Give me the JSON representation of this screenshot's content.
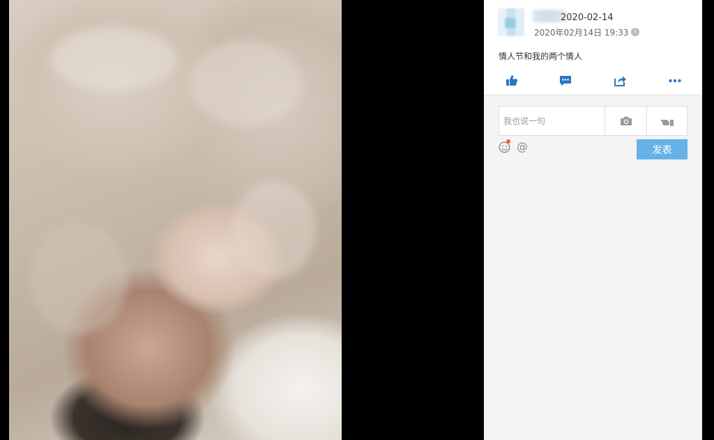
{
  "viewer": {
    "photo_alt": "",
    "close_symbol": "×"
  },
  "post": {
    "title": "2020-02-14",
    "time": "2020年02月14日 19:33",
    "info_symbol": "i",
    "caption": "情人节和我的两个情人"
  },
  "actions": [
    {
      "icon": "thumbs-up-icon"
    },
    {
      "icon": "comment-icon"
    },
    {
      "icon": "share-icon"
    },
    {
      "icon": "more-icon"
    }
  ],
  "comment": {
    "placeholder": "我也说一句",
    "submit_label": "发表",
    "at_symbol": "@"
  },
  "colors": {
    "accent": "#2d76c5",
    "submit": "#66b2e8",
    "notify_dot": "#f06a1d"
  }
}
